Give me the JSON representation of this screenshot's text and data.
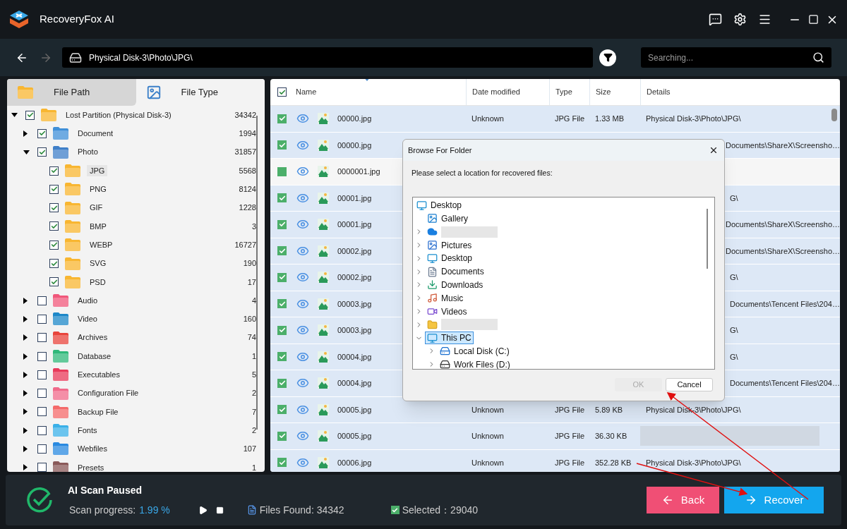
{
  "app": {
    "title": "RecoveryFox AI"
  },
  "toolbar": {
    "path": "Physical Disk-3\\Photo\\JPG\\",
    "search": {
      "placeholder": "Searching..."
    }
  },
  "side_tabs": [
    {
      "label": "File Path",
      "selected": false
    },
    {
      "label": "File Type",
      "selected": true
    }
  ],
  "tree": [
    {
      "label": "Lost Partition (Physical Disk-3)",
      "count": "34342",
      "checked": true,
      "expanded": true,
      "color": "#f8b631",
      "children": [
        {
          "label": "Document",
          "count": "1994",
          "checked": true,
          "expanded": false,
          "color": "#3f8fd8"
        },
        {
          "label": "Photo",
          "count": "31857",
          "checked": true,
          "expanded": true,
          "color": "#3f7fc8",
          "children": [
            {
              "label": "JPG",
              "count": "5568",
              "checked": true,
              "selected": true,
              "color": "#f8b631"
            },
            {
              "label": "PNG",
              "count": "8124",
              "checked": true,
              "selected": false,
              "color": "#f8b631"
            },
            {
              "label": "GIF",
              "count": "1228",
              "checked": true,
              "selected": false,
              "color": "#f8b631"
            },
            {
              "label": "BMP",
              "count": "3",
              "checked": true,
              "selected": false,
              "color": "#f8b631"
            },
            {
              "label": "WEBP",
              "count": "16727",
              "checked": true,
              "selected": false,
              "color": "#f8b631"
            },
            {
              "label": "SVG",
              "count": "190",
              "checked": true,
              "selected": false,
              "color": "#f8b631"
            },
            {
              "label": "PSD",
              "count": "17",
              "checked": true,
              "selected": false,
              "color": "#f8b631"
            }
          ]
        },
        {
          "label": "Audio",
          "count": "4",
          "checked": false,
          "expanded": false,
          "color": "#f0577a"
        },
        {
          "label": "Video",
          "count": "160",
          "checked": false,
          "expanded": false,
          "color": "#1e88c8"
        },
        {
          "label": "Archives",
          "count": "74",
          "checked": false,
          "expanded": false,
          "color": "#e8453c"
        },
        {
          "label": "Database",
          "count": "1",
          "checked": false,
          "expanded": false,
          "color": "#2fb87a"
        },
        {
          "label": "Executables",
          "count": "5",
          "checked": false,
          "expanded": false,
          "color": "#e83a5a"
        },
        {
          "label": "Configuration File",
          "count": "2",
          "checked": false,
          "expanded": false,
          "color": "#f06a8a"
        },
        {
          "label": "Backup File",
          "count": "7",
          "checked": false,
          "expanded": false,
          "color": "#f46a6a"
        },
        {
          "label": "Fonts",
          "count": "2",
          "checked": false,
          "expanded": false,
          "color": "#3ab0e8"
        },
        {
          "label": "Webfiles",
          "count": "107",
          "checked": false,
          "expanded": false,
          "color": "#2a8ae0"
        },
        {
          "label": "Presets",
          "count": "1",
          "checked": false,
          "expanded": false,
          "color": "#8a5a5a"
        }
      ]
    }
  ],
  "table": {
    "all_checked": true,
    "columns": [
      "Name",
      "Date modified",
      "Type",
      "Size",
      "Details"
    ],
    "rows": [
      {
        "name": "00000.jpg",
        "date": "Unknown",
        "type": "JPG File",
        "size": "1.33 MB",
        "details": "Physical Disk-3\\Photo\\JPG\\",
        "selected": true
      },
      {
        "name": "00000.jpg",
        "details": "Documents\\ShareX\\Screensho…",
        "selected": true
      },
      {
        "name": "0000001.jpg",
        "selected": false
      },
      {
        "name": "00001.jpg",
        "details": "G\\",
        "selected": true
      },
      {
        "name": "00001.jpg",
        "details": "Documents\\ShareX\\Screensho…",
        "selected": true
      },
      {
        "name": "00002.jpg",
        "details": "Documents\\ShareX\\Screensho…",
        "selected": true
      },
      {
        "name": "00002.jpg",
        "details": "G\\",
        "selected": true
      },
      {
        "name": "00003.jpg",
        "details": "Documents\\Tencent Files\\204…",
        "selected": true
      },
      {
        "name": "00003.jpg",
        "details": "G\\",
        "selected": true
      },
      {
        "name": "00004.jpg",
        "details": "G\\",
        "selected": true
      },
      {
        "name": "00004.jpg",
        "details": "Documents\\Tencent Files\\204…",
        "selected": true
      },
      {
        "name": "00005.jpg",
        "date": "Unknown",
        "type": "JPG File",
        "size": "5.89 KB",
        "details": "Physical Disk-3\\Photo\\JPG\\",
        "selected": true
      },
      {
        "name": "00005.jpg",
        "date": "Unknown",
        "type": "JPG File",
        "size": "36.30 KB",
        "selected": true
      },
      {
        "name": "00006.jpg",
        "date": "Unknown",
        "type": "JPG File",
        "size": "352.28 KB",
        "details": "Physical Disk-3\\Photo\\JPG\\",
        "selected": true
      }
    ]
  },
  "dialog": {
    "title": "Browse For Folder",
    "prompt": "Please select a location for recovered files:",
    "items": [
      {
        "kind": "desktop",
        "label": "Desktop",
        "selected": false,
        "children": [
          {
            "kind": "gallery",
            "label": "Gallery",
            "selected": false
          },
          {
            "kind": "cloud",
            "selected": false,
            "expanded": false
          },
          {
            "kind": "pictures",
            "label": "Pictures",
            "selected": false,
            "expanded": false
          },
          {
            "kind": "desktop",
            "label": "Desktop",
            "selected": false,
            "expanded": false
          },
          {
            "kind": "documents",
            "label": "Documents",
            "selected": false,
            "expanded": false
          },
          {
            "kind": "downloads",
            "label": "Downloads",
            "selected": false,
            "expanded": false
          },
          {
            "kind": "music",
            "label": "Music",
            "selected": false,
            "expanded": false
          },
          {
            "kind": "videos",
            "label": "Videos",
            "selected": false,
            "expanded": false
          },
          {
            "kind": "folder",
            "selected": false,
            "expanded": false
          },
          {
            "kind": "pc",
            "label": "This PC",
            "selected": true,
            "expanded": true,
            "children": [
              {
                "kind": "disk",
                "label": "Local Disk (C:)",
                "selected": false,
                "expanded": false
              },
              {
                "kind": "drive",
                "label": "Work Files (D:)",
                "selected": false,
                "expanded": false
              }
            ]
          }
        ]
      }
    ],
    "buttons": [
      {
        "label": "OK",
        "disabled": true
      },
      {
        "label": "Cancel",
        "disabled": false
      }
    ]
  },
  "status": {
    "title": "AI Scan Paused",
    "progress_label": "Scan progress:",
    "progress": "1.99 %",
    "files_found": "Files Found: 34342",
    "selected": "Selected：29040"
  },
  "actions": [
    {
      "kind": "back",
      "label": "Back"
    },
    {
      "kind": "recover",
      "label": "Recover"
    }
  ]
}
